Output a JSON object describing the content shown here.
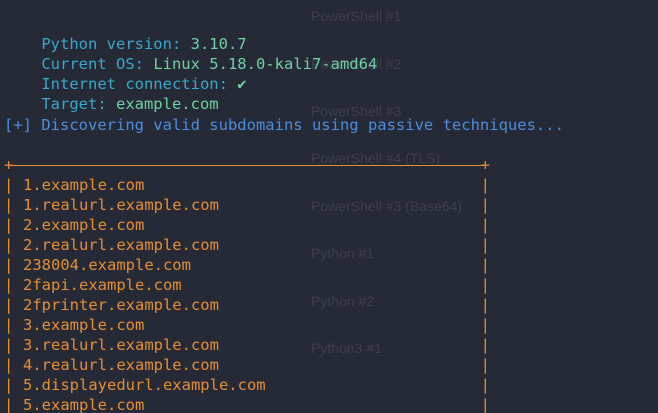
{
  "info": [
    {
      "label": "Python version: ",
      "value": "3.10.7"
    },
    {
      "label": "Current OS: ",
      "value": "Linux 5.18.0-kali7-amd64"
    },
    {
      "label": "Internet connection: ",
      "value": "✔"
    },
    {
      "label": "Target: ",
      "value": "example.com"
    }
  ],
  "status_message": "[+] Discovering valid subdomains using passive techniques...",
  "table": {
    "corner_symbol": "+",
    "pipe_symbol": "|",
    "rows": [
      "1.example.com",
      "1.realurl.example.com",
      "2.example.com",
      "2.realurl.example.com",
      "238004.example.com",
      "2fapi.example.com",
      "2fprinter.example.com",
      "3.example.com",
      "3.realurl.example.com",
      "4.realurl.example.com",
      "5.displayedurl.example.com",
      "5.example.com"
    ]
  },
  "background_ghost_items": [
    "PowerShell #1",
    "PowerShell #2",
    "PowerShell #3",
    "PowerShell #4 (TLS)",
    "PowerShell #3 (Base64)",
    "Python #1",
    "Python #2",
    "Python3 #1"
  ],
  "colors": {
    "background": "#262936",
    "label": "#3aa8c9",
    "value": "#6fd1a5",
    "status": "#4b8fdf",
    "table": "#e58f37",
    "ghost": "#3d404d"
  }
}
